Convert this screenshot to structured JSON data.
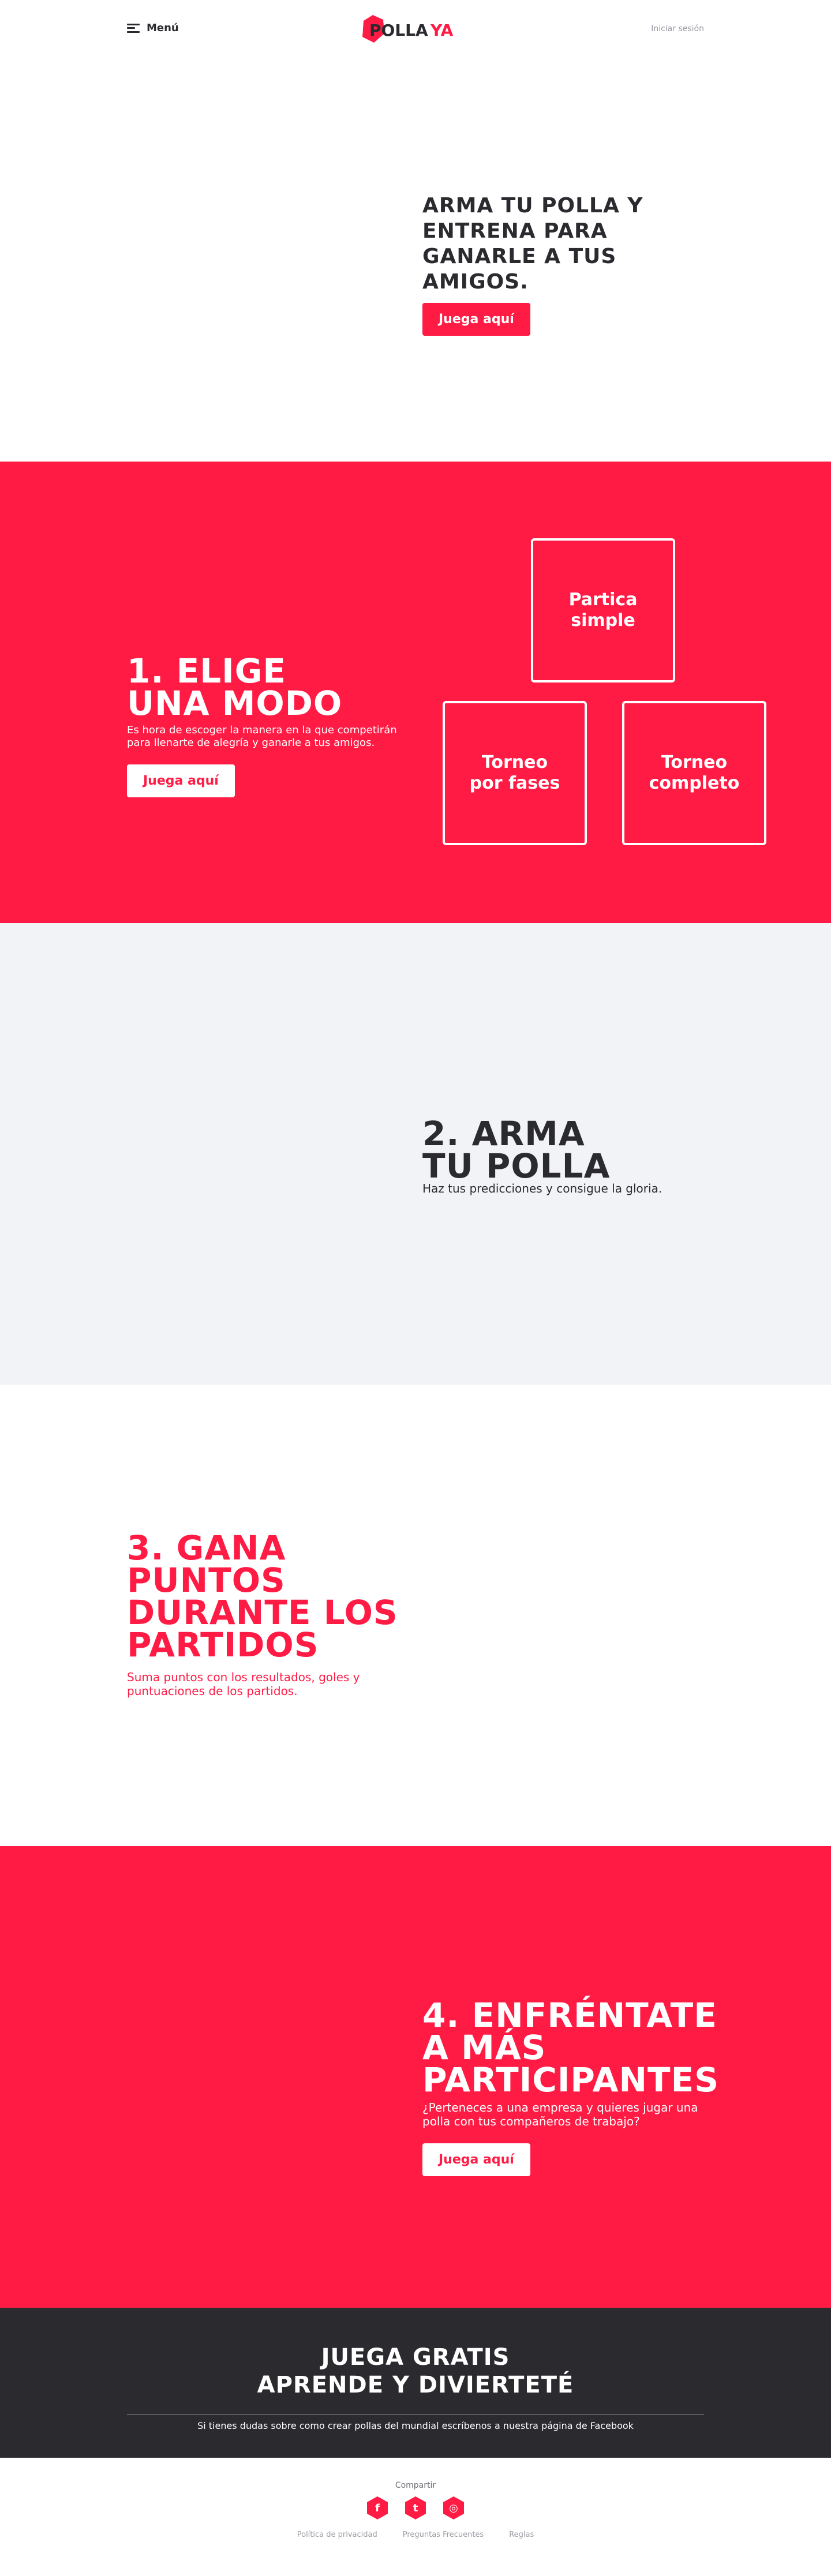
{
  "header": {
    "menu_label": "Menú",
    "logo_text_1": "POLLA",
    "logo_text_2": "YA",
    "login_label": "Iniciar sesión"
  },
  "hero": {
    "title_line_1": "ARMA TU POLLA Y",
    "title_line_2": "ENTRENA PARA",
    "title_line_3": "GANARLE A TUS AMIGOS.",
    "cta_label": "Juega aquí"
  },
  "step1": {
    "title_line_1": "1. ELIGE",
    "title_line_2": "UNA MODO",
    "description": "Es hora de escoger la manera en la que competirán para llenarte de alegría y ganarle a tus amigos.",
    "cta_label": "Juega aquí",
    "modes": [
      {
        "line_1": "Partica",
        "line_2": "simple"
      },
      {
        "line_1": "Torneo",
        "line_2": "por fases"
      },
      {
        "line_1": "Torneo",
        "line_2": "completo"
      }
    ]
  },
  "step2": {
    "title_line_1": "2. ARMA",
    "title_line_2": "TU POLLA",
    "description": "Haz tus predicciones y consigue la gloria."
  },
  "step3": {
    "title_line_1": "3. GANA",
    "title_line_2": "PUNTOS",
    "title_line_3": "DURANTE LOS",
    "title_line_4": "PARTIDOS",
    "description": "Suma puntos con los resultados, goles y puntuaciones de los partidos."
  },
  "step4": {
    "title_line_1": "4. ENFRÉNTATE",
    "title_line_2": "A MÁS",
    "title_line_3": "PARTICIPANTES",
    "description": "¿Perteneces a una empresa y quieres jugar una polla con tus compañeros de trabajo?",
    "cta_label": "Juega aquí"
  },
  "cta_band": {
    "title_line_1": "JUEGA GRATIS",
    "title_line_2": "APRENDE Y DIVIERTETÉ",
    "note": "Si tienes dudas sobre como crear pollas del mundial escríbenos a nuestra página de Facebook"
  },
  "footer": {
    "share_label": "Compartir",
    "social_icons": [
      "facebook-icon",
      "twitter-icon",
      "instagram-icon"
    ],
    "social_glyphs": [
      "f",
      "t",
      "◎"
    ],
    "links": [
      "Política de privacidad",
      "Preguntas Frecuentes",
      "Reglas"
    ]
  },
  "colors": {
    "accent": "#ff1b44",
    "dark": "#2a2a2f",
    "light_grey": "#f2f3f7",
    "muted": "#9a9aa3"
  }
}
